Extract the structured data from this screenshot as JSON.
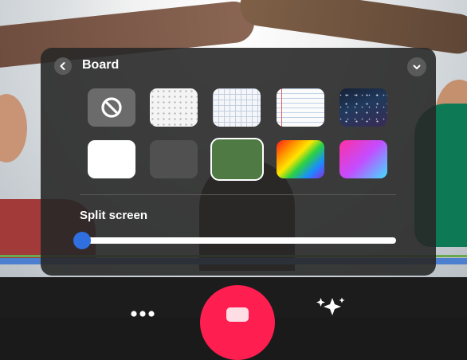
{
  "panel": {
    "title": "Board",
    "backgrounds": [
      {
        "name": "none"
      },
      {
        "name": "dots"
      },
      {
        "name": "grid"
      },
      {
        "name": "lined-paper"
      },
      {
        "name": "space"
      },
      {
        "name": "white"
      },
      {
        "name": "gray"
      },
      {
        "name": "green",
        "selected": true
      },
      {
        "name": "rainbow-gradient"
      },
      {
        "name": "pink-blue-gradient"
      }
    ],
    "split_screen": {
      "label": "Split screen",
      "value": 0
    }
  },
  "colors": {
    "accent": "#2f6fe0",
    "record": "#ff1e50",
    "selected_tile": "#4f7a44"
  },
  "icons": [
    "back-icon",
    "chevron-down-icon",
    "no-background-icon",
    "dots-menu-icon",
    "record-icon",
    "effects-icon"
  ]
}
